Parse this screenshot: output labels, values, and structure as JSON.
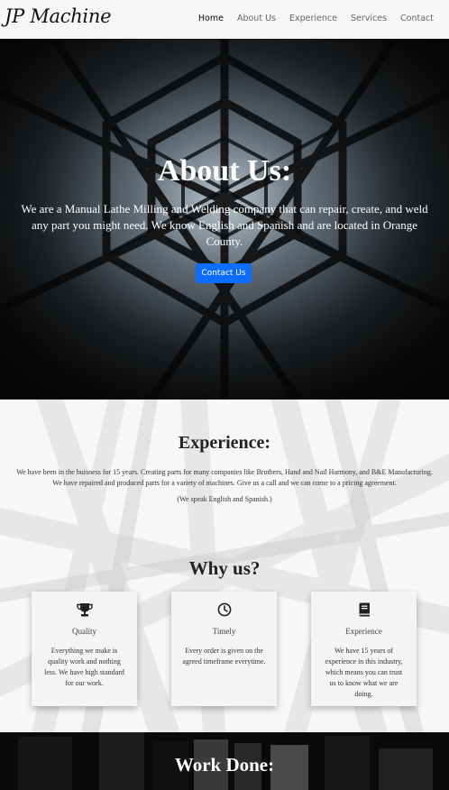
{
  "navbar": {
    "brand": "JP Machine",
    "links": [
      "Home",
      "About Us",
      "Experience",
      "Services",
      "Contact"
    ]
  },
  "hero": {
    "title": "About Us:",
    "text": "We are a Manual Lathe Milling and Welding company that can repair, create, and weld any part you might need. We know English and Spanish and are located in Orange County.",
    "button": "Contact Us"
  },
  "experience": {
    "title": "Experience:",
    "text": "We have been in the buisness for 15 years. Creating parts for many companies like Brothers, Hand and Nail Harmony, and B&E Manufacturing. We have repaired and produced parts for a variety of machines. Give us a call and we can come to a pricing agreement.",
    "note": "(We speak English and Spanish.)"
  },
  "why": {
    "title": "Why us?",
    "cards": [
      {
        "icon": "trophy-icon",
        "title": "Quality",
        "text": "Everything we make is quality work and nothing less. We have high standard for our work."
      },
      {
        "icon": "clock-icon",
        "title": "Timely",
        "text": "Every order is given on the agreed timeframe everytime."
      },
      {
        "icon": "book-icon",
        "title": "Experience",
        "text": "We have 15 years of experience in this industry, which means you can trust us to know what we are doing."
      }
    ]
  },
  "work": {
    "title": "Work Done:"
  },
  "colors": {
    "accent": "#0d6efd",
    "navbar_bg": "#f6f6f6",
    "hero_overlay": "#151515"
  }
}
